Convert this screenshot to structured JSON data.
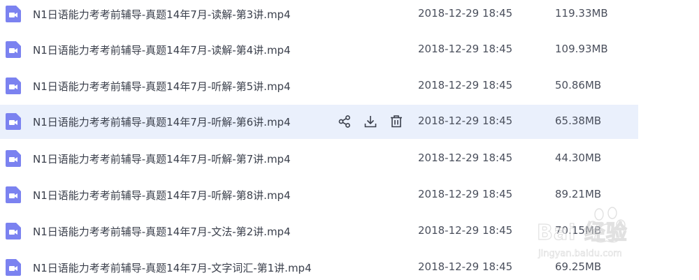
{
  "files": [
    {
      "name": "N1日语能力考考前辅导-真题14年7月-读解-第3讲.mp4",
      "date": "2018-12-29 18:45",
      "size": "119.33MB"
    },
    {
      "name": "N1日语能力考考前辅导-真题14年7月-读解-第4讲.mp4",
      "date": "2018-12-29 18:45",
      "size": "109.93MB"
    },
    {
      "name": "N1日语能力考考前辅导-真题14年7月-听解-第5讲.mp4",
      "date": "2018-12-29 18:45",
      "size": "50.86MB"
    },
    {
      "name": "N1日语能力考考前辅导-真题14年7月-听解-第6讲.mp4",
      "date": "2018-12-29 18:45",
      "size": "65.38MB"
    },
    {
      "name": "N1日语能力考考前辅导-真题14年7月-听解-第7讲.mp4",
      "date": "2018-12-29 18:45",
      "size": "44.30MB"
    },
    {
      "name": "N1日语能力考考前辅导-真题14年7月-听解-第8讲.mp4",
      "date": "2018-12-29 18:45",
      "size": "89.21MB"
    },
    {
      "name": "N1日语能力考考前辅导-真题14年7月-文法-第2讲.mp4",
      "date": "2018-12-29 18:45",
      "size": "70.15MB"
    },
    {
      "name": "N1日语能力考考前辅导-真题14年7月-文字词汇-第1讲.mp4",
      "date": "2018-12-29 18:45",
      "size": "69.25MB"
    }
  ],
  "hovered_row": 3,
  "actions": {
    "share_icon": "share-icon",
    "download_icon": "download-icon",
    "delete_icon": "trash-icon"
  },
  "watermark": {
    "main": "Bai 经验",
    "sub": "jingyan.baidu.com"
  },
  "colors": {
    "video_icon": "#7b82f0",
    "hover_bg": "#eaf0fc",
    "action_icon": "#3a3f4b"
  }
}
